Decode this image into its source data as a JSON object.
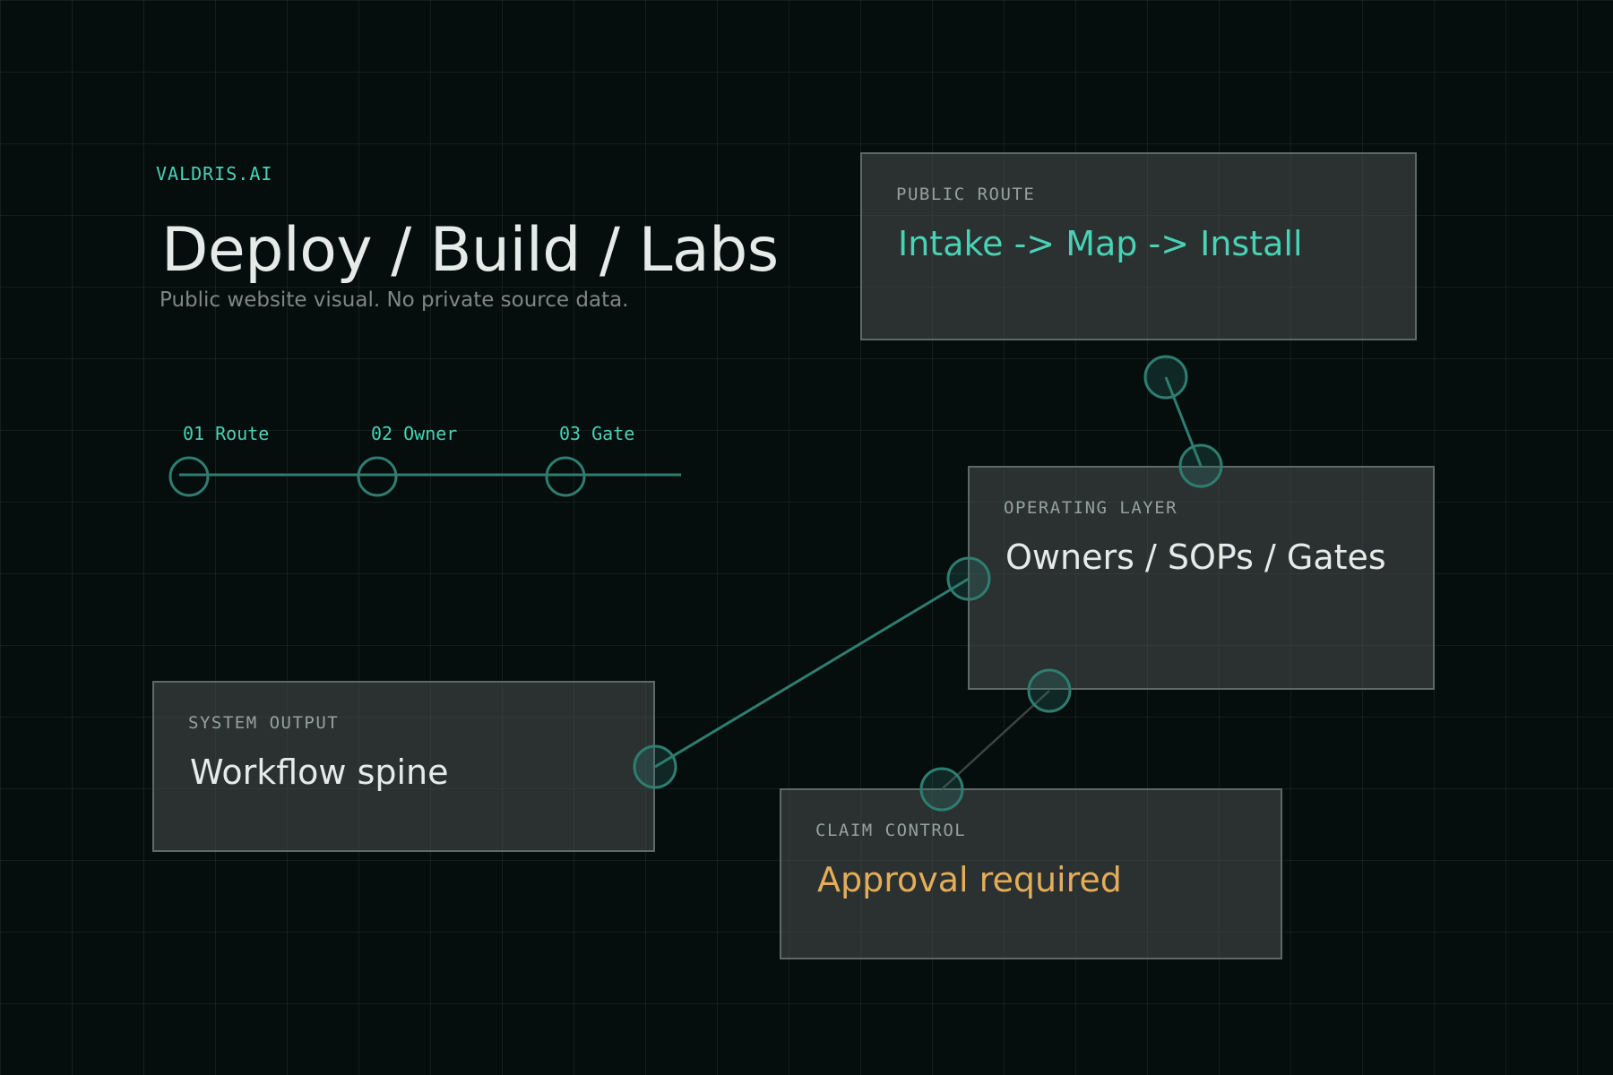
{
  "brand": "VALDRIS.AI",
  "title": "Deploy / Build / Labs",
  "subtitle": "Public website visual. No private source data.",
  "steps": [
    {
      "label": "01 Route"
    },
    {
      "label": "02 Owner"
    },
    {
      "label": "03 Gate"
    }
  ],
  "cards": {
    "public_route": {
      "label": "PUBLIC ROUTE",
      "value": "Intake -> Map -> Install"
    },
    "operating_layer": {
      "label": "OPERATING LAYER",
      "value": "Owners / SOPs / Gates"
    },
    "system_output": {
      "label": "SYSTEM OUTPUT",
      "value": "Workflow spine"
    },
    "claim_control": {
      "label": "CLAIM CONTROL",
      "value": "Approval required"
    }
  },
  "colors": {
    "accent": "#48d2b6",
    "warning": "#e4ad5a",
    "text": "#e6ebe9",
    "node_stroke": "#2e7d70",
    "background": "#060d0d"
  }
}
